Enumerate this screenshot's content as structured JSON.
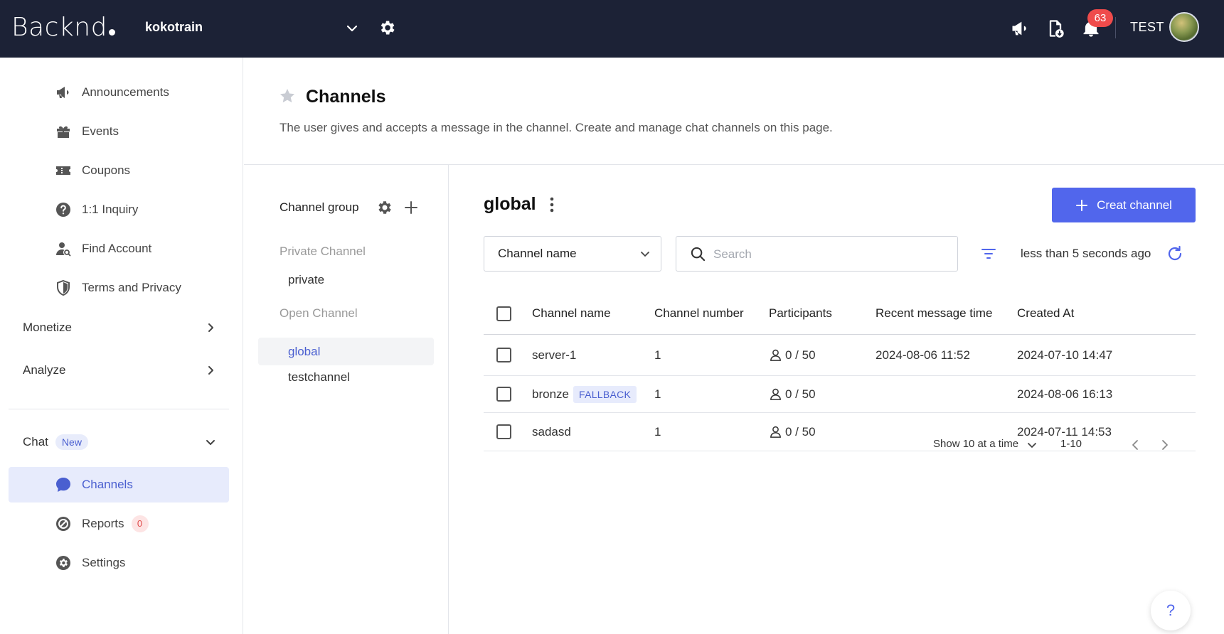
{
  "topbar": {
    "logo": "Backnd",
    "project": "kokotrain",
    "notification_count": "63",
    "user": "TEST"
  },
  "sidebar": {
    "items": [
      {
        "label": "Announcements",
        "icon": "megaphone-icon"
      },
      {
        "label": "Events",
        "icon": "gift-icon"
      },
      {
        "label": "Coupons",
        "icon": "ticket-icon"
      },
      {
        "label": "1:1 Inquiry",
        "icon": "question-icon"
      },
      {
        "label": "Find Account",
        "icon": "user-search-icon"
      },
      {
        "label": "Terms and Privacy",
        "icon": "shield-icon"
      }
    ],
    "groups": [
      {
        "label": "Monetize"
      },
      {
        "label": "Analyze"
      }
    ],
    "chat": {
      "label": "Chat",
      "badge": "New",
      "items": [
        {
          "label": "Channels",
          "icon": "chat-bubble-icon"
        },
        {
          "label": "Reports",
          "icon": "report-icon",
          "count": "0"
        },
        {
          "label": "Settings",
          "icon": "settings-icon"
        }
      ]
    }
  },
  "page": {
    "title": "Channels",
    "description": "The user gives and accepts a message in the channel. Create and manage chat channels on this page."
  },
  "channel_groups": {
    "title": "Channel group",
    "sections": [
      {
        "label": "Private Channel",
        "items": [
          "private"
        ]
      },
      {
        "label": "Open Channel",
        "items": [
          "global",
          "testchannel"
        ]
      }
    ],
    "active": "global"
  },
  "main": {
    "title": "global",
    "create_button": "Creat channel",
    "select_value": "Channel name",
    "search_placeholder": "Search",
    "refresh_text": "less than 5 seconds ago",
    "columns": [
      "Channel name",
      "Channel number",
      "Participants",
      "Recent message time",
      "Created At"
    ],
    "rows": [
      {
        "name": "server-1",
        "tag": "",
        "number": "1",
        "participants": "0 / 50",
        "recent": "2024-08-06 11:52",
        "created": "2024-07-10 14:47"
      },
      {
        "name": "bronze",
        "tag": "FALLBACK",
        "number": "1",
        "participants": "0 / 50",
        "recent": "",
        "created": "2024-08-06 16:13"
      },
      {
        "name": "sadasd",
        "tag": "",
        "number": "1",
        "participants": "0 / 50",
        "recent": "",
        "created": "2024-07-11 14:53"
      }
    ],
    "pager": {
      "page_size": "Show 10 at a time",
      "range": "1-10"
    }
  },
  "help_label": "?",
  "colors": {
    "topbar": "#1c2236",
    "accent": "#5166ec",
    "badge": "#ef4b4b"
  }
}
